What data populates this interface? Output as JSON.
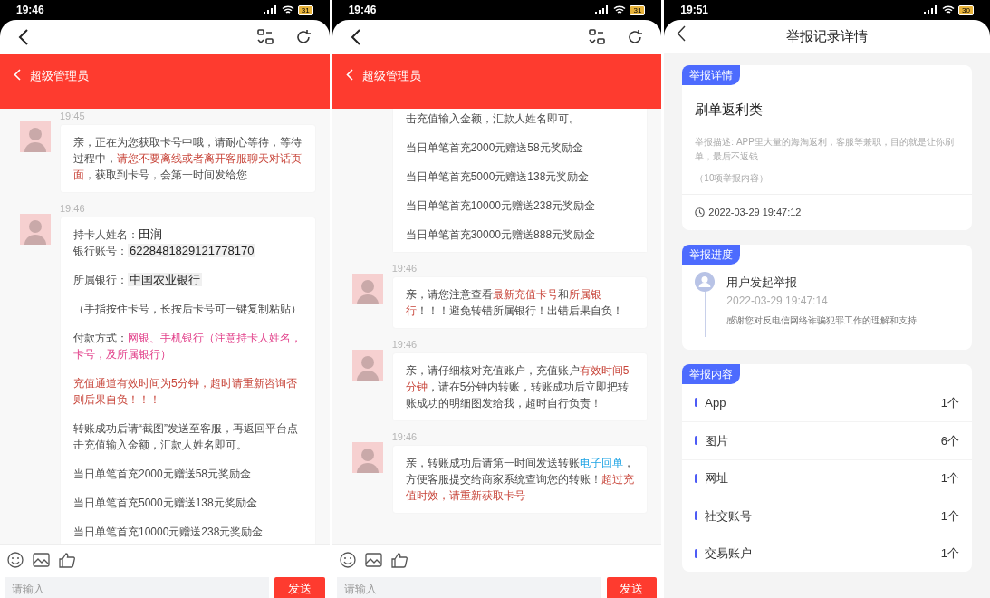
{
  "screens": [
    {
      "kind": "chat",
      "status_bar": {
        "time": "19:46",
        "battery": "31"
      },
      "chat_title": "超级管理员",
      "messages": [
        {
          "time": "19:45",
          "paragraphs": [
            [
              [
                {
                  "kind": "plain",
                  "text": "亲，正在为您获取卡号中哦，请耐心等待，等待过程中，"
                },
                {
                  "kind": "warning",
                  "text": "请您不要离线或者离开客服聊天对话页面"
                },
                {
                  "kind": "plain",
                  "text": "，获取到卡号，会第一时间发给您"
                }
              ]
            ]
          ]
        },
        {
          "time": "19:46",
          "paragraphs": [
            [
              [
                {
                  "kind": "plain",
                  "text": "持卡人姓名："
                },
                {
                  "kind": "strong",
                  "text": "田润"
                }
              ],
              [
                {
                  "kind": "plain",
                  "text": "银行账号："
                },
                {
                  "kind": "highlight",
                  "text": "6228481829121778170"
                }
              ]
            ],
            [
              [
                {
                  "kind": "plain",
                  "text": "所属银行："
                },
                {
                  "kind": "highlight",
                  "text": "中国农业银行"
                }
              ]
            ],
            [
              [
                {
                  "kind": "plain",
                  "text": "（手指按住卡号，长按后卡号可一键复制粘贴）"
                }
              ]
            ],
            [
              [
                {
                  "kind": "plain",
                  "text": "付款方式："
                },
                {
                  "kind": "pink",
                  "text": "网银、手机银行（注意持卡人姓名，卡号，及所属银行）"
                }
              ]
            ],
            [
              [
                {
                  "kind": "warning",
                  "text": "充值通道有效时间为5分钟，超时请重新咨询否则后果自负！！！"
                }
              ]
            ],
            [
              [
                {
                  "kind": "plain",
                  "text": "转账成功后请“截图”发送至客服，再返回平台点击充值输入金额，汇款人姓名即可。"
                }
              ]
            ],
            [
              [
                {
                  "kind": "plain",
                  "text": "当日单笔首充2000元赠送58元奖励金"
                }
              ]
            ],
            [
              [
                {
                  "kind": "plain",
                  "text": "当日单笔首充5000元赠送138元奖励金"
                }
              ]
            ],
            [
              [
                {
                  "kind": "plain",
                  "text": "当日单笔首充10000元赠送238元奖励金"
                }
              ]
            ]
          ]
        }
      ],
      "input": {
        "placeholder": "请输入"
      },
      "send_button": "发送"
    },
    {
      "kind": "chat",
      "status_bar": {
        "time": "19:46",
        "battery": "31"
      },
      "chat_title": "超级管理员",
      "messages": [
        {
          "paragraphs": [
            [
              [
                {
                  "kind": "plain",
                  "text": "击充值输入金额，汇款人姓名即可。"
                }
              ]
            ],
            [
              [
                {
                  "kind": "plain",
                  "text": "当日单笔首充2000元赠送58元奖励金"
                }
              ]
            ],
            [
              [
                {
                  "kind": "plain",
                  "text": "当日单笔首充5000元赠送138元奖励金"
                }
              ]
            ],
            [
              [
                {
                  "kind": "plain",
                  "text": "当日单笔首充10000元赠送238元奖励金"
                }
              ]
            ],
            [
              [
                {
                  "kind": "plain",
                  "text": "当日单笔首充30000元赠送888元奖励金"
                }
              ]
            ]
          ]
        },
        {
          "time": "19:46",
          "paragraphs": [
            [
              [
                {
                  "kind": "plain",
                  "text": "亲，请您注意查看"
                },
                {
                  "kind": "warning",
                  "text": "最新充值卡号"
                },
                {
                  "kind": "plain",
                  "text": "和"
                },
                {
                  "kind": "warning",
                  "text": "所属银行"
                },
                {
                  "kind": "plain",
                  "text": "！！！避免转错所属银行！出错后果自负！"
                }
              ]
            ]
          ]
        },
        {
          "time": "19:46",
          "paragraphs": [
            [
              [
                {
                  "kind": "plain",
                  "text": "亲，请仔细核对充值账户，充值账户"
                },
                {
                  "kind": "warning",
                  "text": "有效时间5分钟"
                },
                {
                  "kind": "plain",
                  "text": "，请在5分钟内转账，转账成功后立即把转账成功的明细图发给我，超时自行负责！"
                }
              ]
            ]
          ]
        },
        {
          "time": "19:46",
          "paragraphs": [
            [
              [
                {
                  "kind": "plain",
                  "text": "亲，转账成功后请第一时间发送转账"
                },
                {
                  "kind": "link",
                  "text": "电子回单"
                },
                {
                  "kind": "plain",
                  "text": "，方便客服提交给商家系统查询您的转账！"
                },
                {
                  "kind": "warning",
                  "text": "超过充值时效，请重新获取卡号"
                }
              ]
            ]
          ]
        }
      ],
      "input": {
        "placeholder": "请输入"
      },
      "send_button": "发送"
    },
    {
      "kind": "report",
      "status_bar": {
        "time": "19:51",
        "battery": "30"
      },
      "title": "举报记录详情",
      "detail": {
        "tag": "举报详情",
        "category": "刷单返利类",
        "description": "举报描述: APP里大量的海淘返利，客服等兼职，目的就是让你刷单，最后不返钱",
        "count": "（10项举报内容）",
        "time": "2022-03-29 19:47:12"
      },
      "progress": {
        "tag": "举报进度",
        "step": "用户发起举报",
        "time": "2022-03-29 19:47:14",
        "note": "感谢您对反电信网络诈骗犯罪工作的理解和支持"
      },
      "content": {
        "tag": "举报内容",
        "items": [
          {
            "label": "App",
            "count": "1个"
          },
          {
            "label": "图片",
            "count": "6个"
          },
          {
            "label": "网址",
            "count": "1个"
          },
          {
            "label": "社交账号",
            "count": "1个"
          },
          {
            "label": "交易账户",
            "count": "1个"
          }
        ]
      }
    }
  ]
}
